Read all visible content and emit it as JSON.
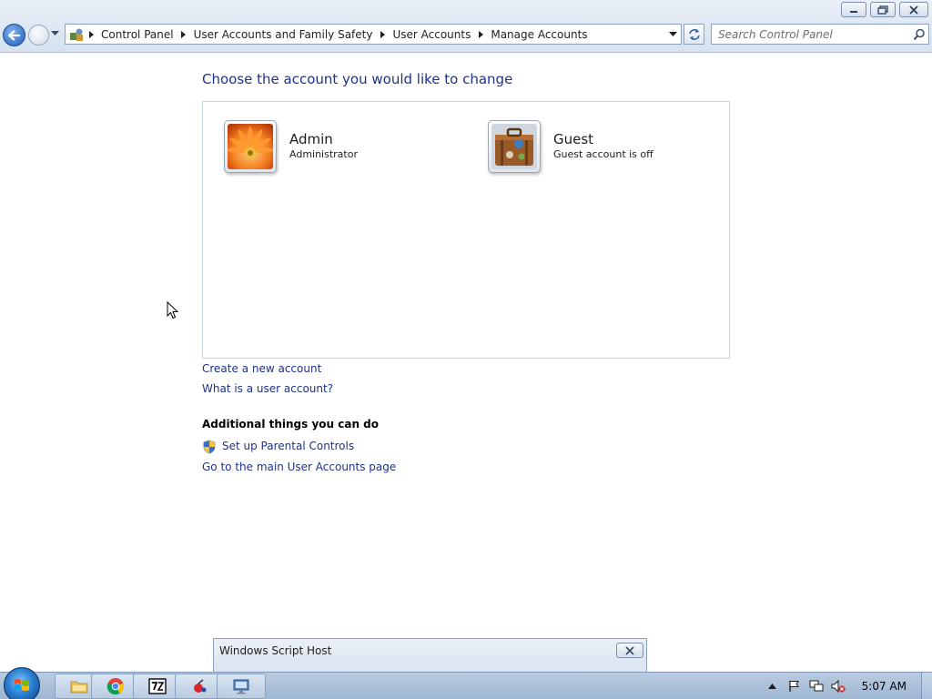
{
  "window": {
    "minimize_icon": "minimize-icon",
    "maximize_icon": "restore-icon",
    "close_icon": "close-icon"
  },
  "addressbar": {
    "crumbs": [
      "Control Panel",
      "User Accounts and Family Safety",
      "User Accounts",
      "Manage Accounts"
    ]
  },
  "search": {
    "placeholder": "Search Control Panel"
  },
  "content": {
    "heading": "Choose the account you would like to change",
    "accounts": [
      {
        "name": "Admin",
        "role": "Administrator",
        "picture": "orange-flower"
      },
      {
        "name": "Guest",
        "role": "Guest account is off",
        "picture": "suitcase"
      }
    ],
    "links": {
      "create_account": "Create a new account",
      "what_is_account": "What is a user account?"
    },
    "additional": {
      "title": "Additional things you can do",
      "parental_controls": "Set up Parental Controls",
      "main_user_accounts": "Go to the main User Accounts page"
    }
  },
  "dialog": {
    "title": "Windows Script Host"
  },
  "taskbar": {
    "pinned": [
      "file-explorer",
      "chrome",
      "7zip",
      "app-red",
      "remote-desktop"
    ],
    "clock": "5:07 AM"
  },
  "colors": {
    "link": "#1e3287",
    "heading": "#1e3287",
    "panel_border": "#c9d3e0"
  }
}
